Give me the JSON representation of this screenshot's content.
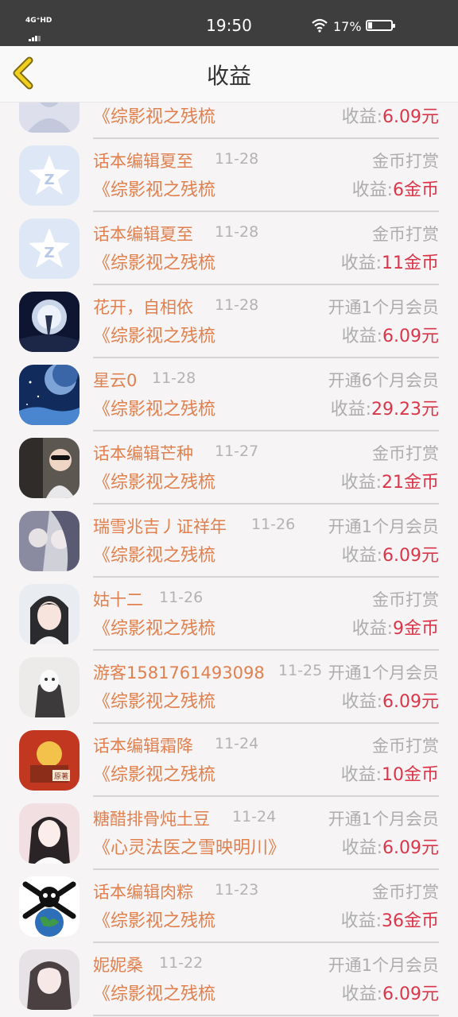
{
  "status_bar": {
    "network": "4G⁺HD",
    "time": "19:50",
    "battery": "17%"
  },
  "header": {
    "title": "收益"
  },
  "earn_label": "收益:",
  "rows": [
    {
      "user": "",
      "date": "",
      "type": "",
      "book": "《综影视之残梳",
      "amount": "6.09元"
    },
    {
      "user": "话本编辑夏至",
      "date": "11-28",
      "type": "金币打赏",
      "book": "《综影视之残梳",
      "amount": "6金币"
    },
    {
      "user": "话本编辑夏至",
      "date": "11-28",
      "type": "金币打赏",
      "book": "《综影视之残梳",
      "amount": "11金币"
    },
    {
      "user": "花开，自相依",
      "date": "11-28",
      "type": "开通1个月会员",
      "book": "《综影视之残梳",
      "amount": "6.09元"
    },
    {
      "user": "星云0",
      "date": "11-28",
      "type": "开通6个月会员",
      "book": "《综影视之残梳",
      "amount": "29.23元"
    },
    {
      "user": "话本编辑芒种",
      "date": "11-27",
      "type": "金币打赏",
      "book": "《综影视之残梳",
      "amount": "21金币"
    },
    {
      "user": "瑞雪兆吉丿证祥年",
      "date": "11-26",
      "type": "开通1个月会员",
      "book": "《综影视之残梳",
      "amount": "6.09元"
    },
    {
      "user": "姑十二",
      "date": "11-26",
      "type": "金币打赏",
      "book": "《综影视之残梳",
      "amount": "9金币"
    },
    {
      "user": "游客1581761493098",
      "date": "11-25",
      "type": "开通1个月会员",
      "book": "《综影视之残梳",
      "amount": "6.09元"
    },
    {
      "user": "话本编辑霜降",
      "date": "11-24",
      "type": "金币打赏",
      "book": "《综影视之残梳",
      "amount": "10金币"
    },
    {
      "user": "糖醋排骨炖土豆",
      "date": "11-24",
      "type": "开通1个月会员",
      "book": "《心灵法医之雪映明川》",
      "amount": "6.09元"
    },
    {
      "user": "话本编辑肉粽",
      "date": "11-23",
      "type": "金币打赏",
      "book": "《综影视之残梳",
      "amount": "36金币"
    },
    {
      "user": "妮妮桑",
      "date": "11-22",
      "type": "开通1个月会员",
      "book": "《综影视之残梳",
      "amount": "6.09元"
    }
  ]
}
